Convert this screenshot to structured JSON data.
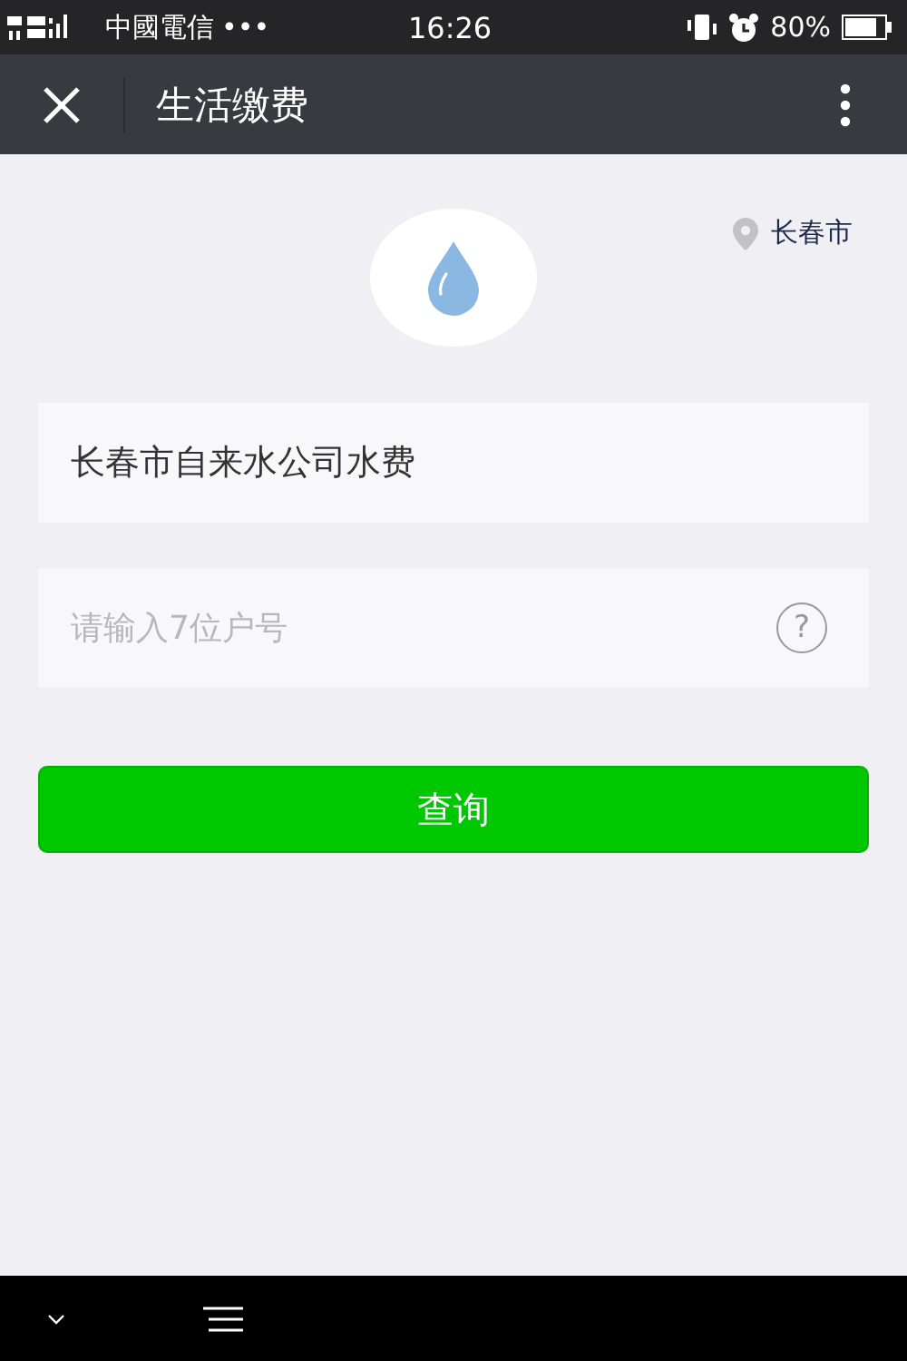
{
  "status_bar": {
    "carrier": "中國電信",
    "more": "•••",
    "time": "16:26",
    "battery": "80%"
  },
  "nav_bar": {
    "title": "生活缴费"
  },
  "location": {
    "city": "长春市"
  },
  "bill_field": {
    "value": "长春市自来水公司水费"
  },
  "account_field": {
    "placeholder": "请输入7位户号",
    "help": "?"
  },
  "query_button": {
    "label": "查询"
  }
}
